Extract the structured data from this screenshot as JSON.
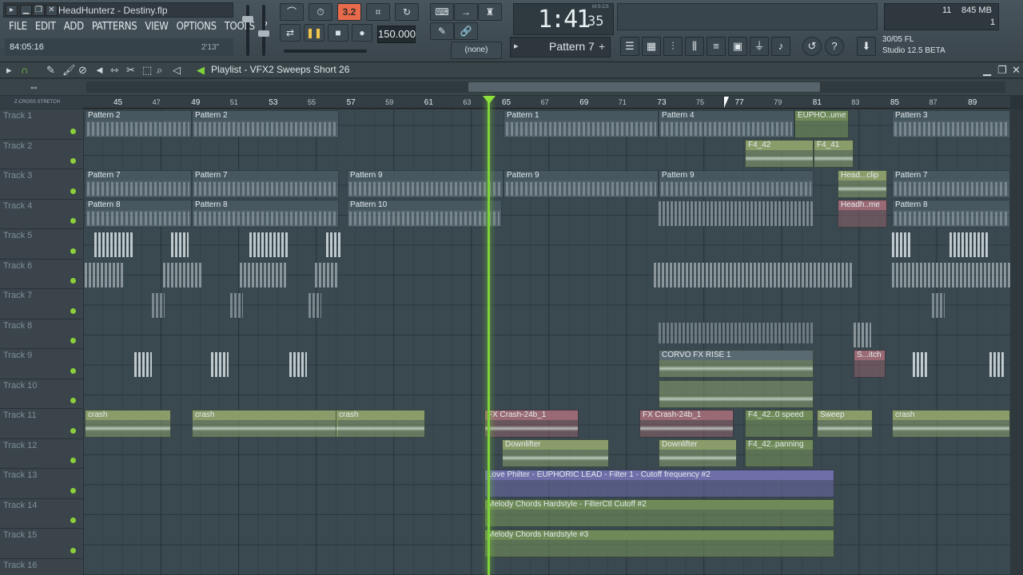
{
  "window": {
    "title": "HeadHunterz - Destiny.flp"
  },
  "menu": [
    "FILE",
    "EDIT",
    "ADD",
    "PATTERNS",
    "VIEW",
    "OPTIONS",
    "TOOLS",
    "?"
  ],
  "song_time": "84:05:16",
  "song_len": "2'13\"",
  "transport": {
    "rec_label": "3.2",
    "tempo": "150.000",
    "snap": "(none)"
  },
  "clock": {
    "time": "1:41",
    "sub": "35",
    "label": "M:S:CS"
  },
  "pattern_selector": "Pattern 7",
  "cpu": {
    "a": "11",
    "mem": "845 MB",
    "c": "1"
  },
  "news": {
    "line1": "30/05  FL",
    "line2": "Studio 12.5 BETA"
  },
  "playlist": {
    "title": "Playlist - VFX2 Sweeps Short 26",
    "ruler_left": "Z-CROSS  STRETCH"
  },
  "ruler": [
    "45",
    "47",
    "49",
    "51",
    "53",
    "55",
    "57",
    "59",
    "61",
    "63",
    "65",
    "67",
    "69",
    "71",
    "73",
    "75",
    "77",
    "79",
    "81",
    "83",
    "85",
    "87",
    "89"
  ],
  "tracks": [
    "Track 1",
    "Track 2",
    "Track 3",
    "Track 4",
    "Track 5",
    "Track 6",
    "Track 7",
    "Track 8",
    "Track 9",
    "Track 10",
    "Track 11",
    "Track 12",
    "Track 13",
    "Track 14",
    "Track 15",
    "Track 16"
  ],
  "clips": {
    "p2a": "Pattern 2",
    "p2b": "Pattern 2",
    "p1": "Pattern 1",
    "p4": "Pattern 4",
    "euph": "EUPHO..ume",
    "p3": "Pattern 3",
    "f4a": "F4_42",
    "f4b": "F4_41",
    "p7a": "Pattern 7",
    "p7b": "Pattern 7",
    "p9a": "Pattern 9",
    "p9b": "Pattern 9",
    "p9c": "Pattern 9",
    "headclip": "Head...clip",
    "p7c": "Pattern 7",
    "p8a": "Pattern 8",
    "p8b": "Pattern 8",
    "p10": "Pattern 10",
    "headme": "Headh..me",
    "p8c": "Pattern 8",
    "corvo": "CORVO FX RISE 1",
    "sitch": "S...itch",
    "crash1": "crash",
    "crash2": "crash",
    "crash3": "crash",
    "fx1": "FX Crash-24b_1",
    "fx2": "FX Crash-24b_1",
    "f4speed": "F4_42..0 speed",
    "sweep": "Sweep",
    "crash4": "crash",
    "down1": "Downlifter",
    "down2": "Downlifter",
    "f4pan": "F4_42..panning",
    "auto1": "Love Philter - EUPHORIC LEAD - Filter 1 - Cutoff frequency #2",
    "auto2": "Melody Chords Hardstyle - FilterCtl Cutoff #2",
    "auto3": "Melody Chords Hardstyle #3"
  }
}
